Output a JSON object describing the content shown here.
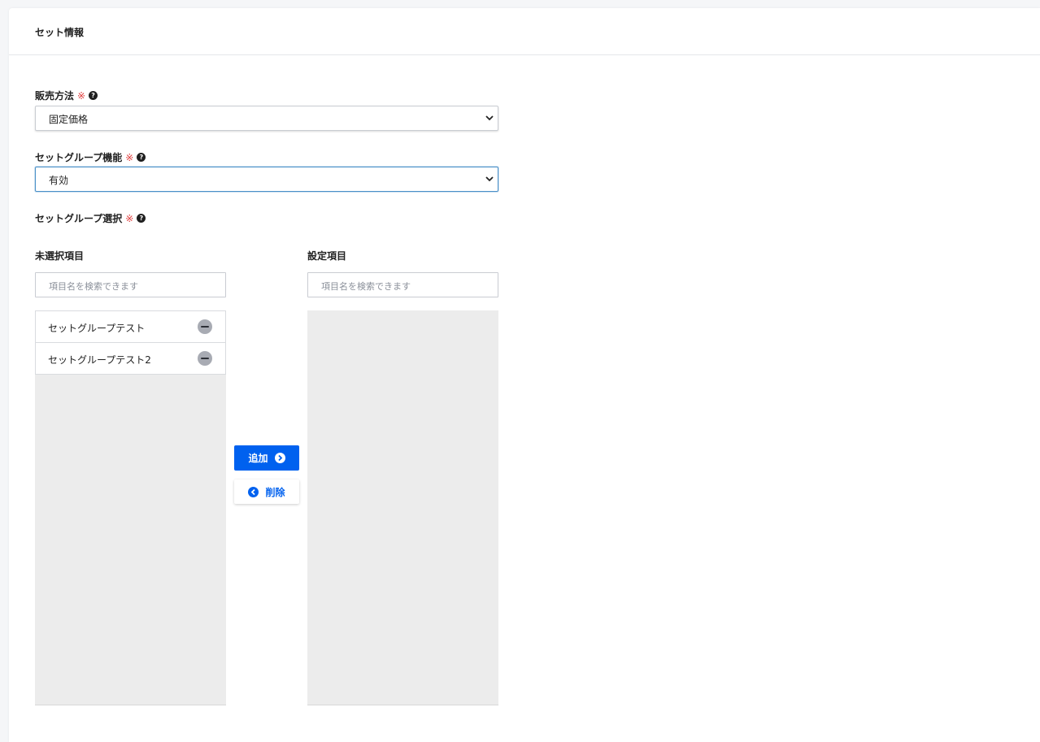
{
  "card": {
    "title": "セット情報"
  },
  "sales_method": {
    "label": "販売方法",
    "required_mark": "※",
    "value": "固定価格"
  },
  "set_group_function": {
    "label": "セットグループ機能",
    "required_mark": "※",
    "value": "有効"
  },
  "set_group_selection": {
    "label": "セットグループ選択",
    "required_mark": "※",
    "unselected": {
      "title": "未選択項目",
      "search_placeholder": "項目名を検索できます",
      "items": [
        {
          "label": "セットグループテスト"
        },
        {
          "label": "セットグループテスト2"
        }
      ]
    },
    "selected": {
      "title": "設定項目",
      "search_placeholder": "項目名を検索できます",
      "items": []
    },
    "add_button": "追加",
    "remove_button": "削除"
  },
  "colors": {
    "primary": "#0061ef",
    "required": "#e03e3e",
    "list_bg": "#ececec"
  },
  "icons": {
    "help": "question-circle-icon",
    "dropdown": "chevron-down-icon",
    "remove_item": "minus-circle-icon",
    "add": "chevron-right-circle-icon",
    "remove": "chevron-left-circle-icon"
  }
}
